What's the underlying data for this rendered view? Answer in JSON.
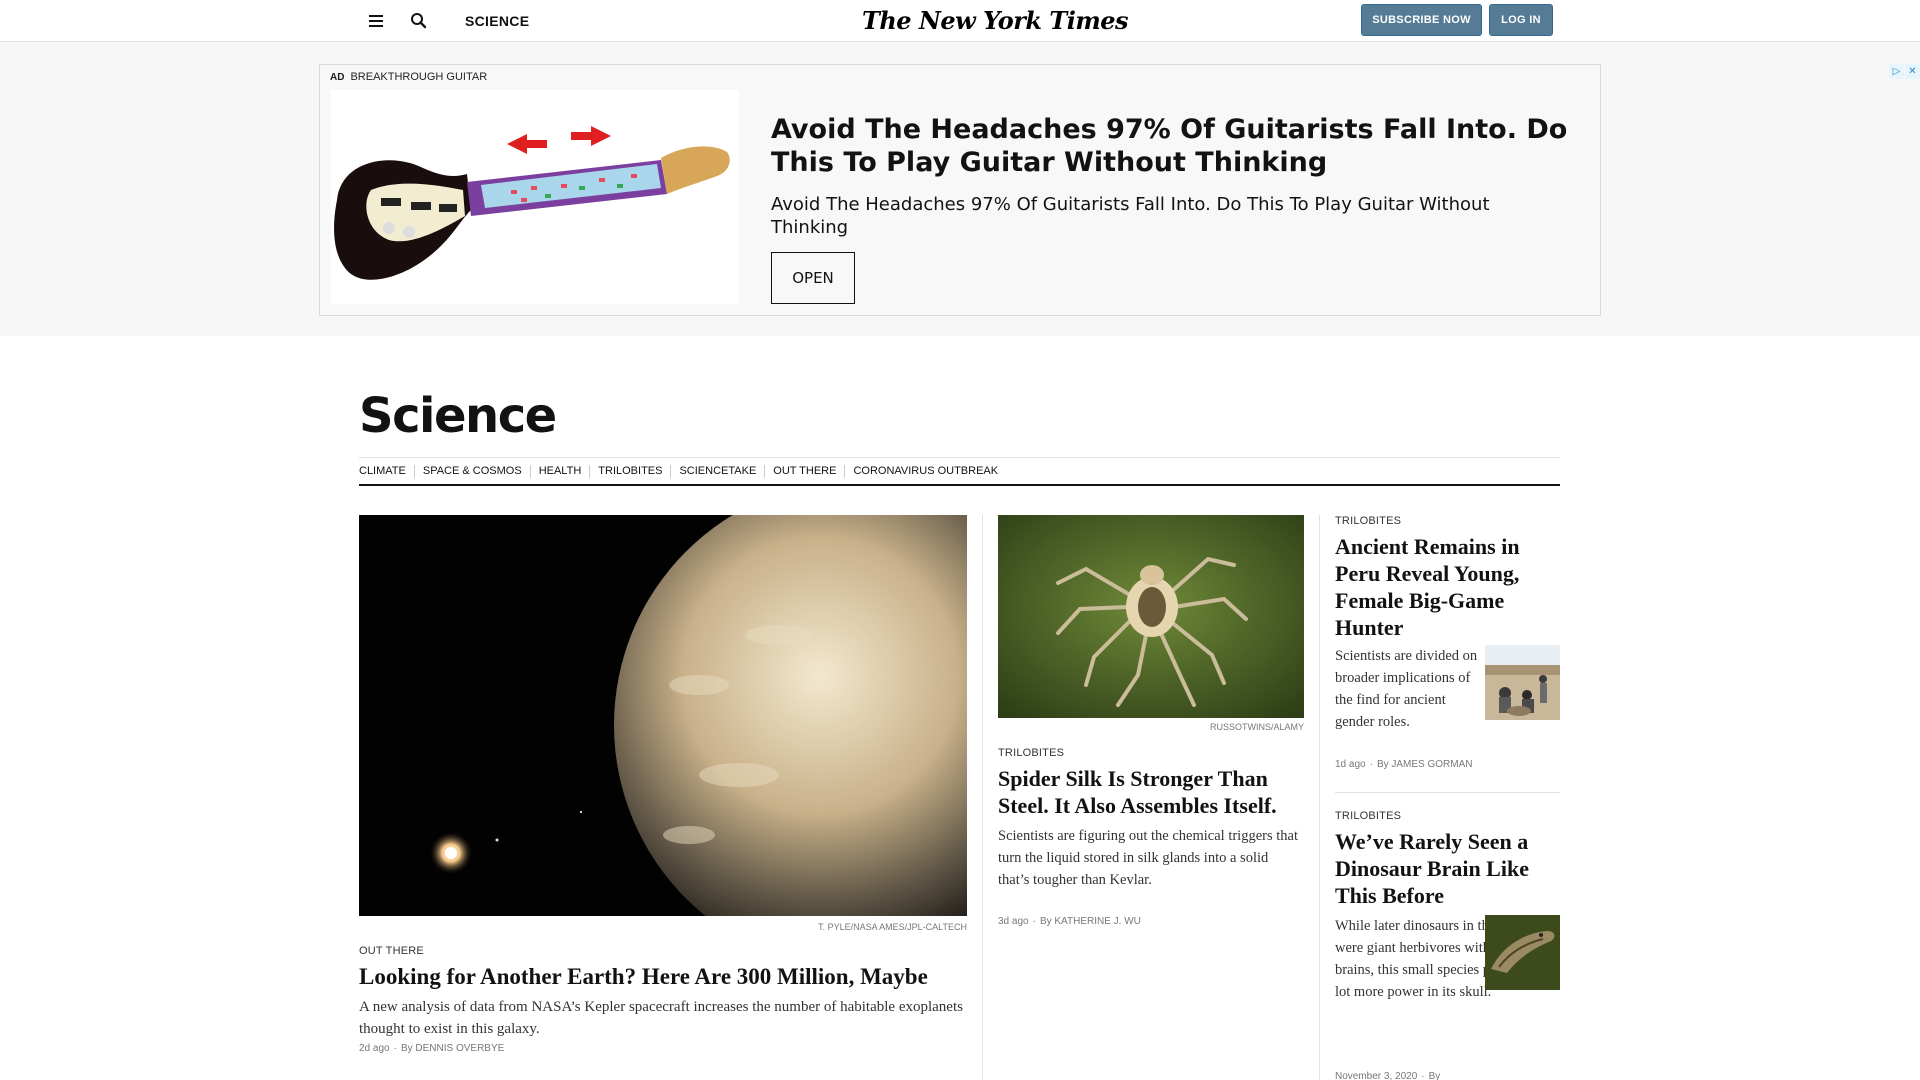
{
  "header": {
    "section": "SCIENCE",
    "masthead": "The New York Times",
    "subscribe_label": "SUBSCRIBE NOW",
    "login_label": "LOG IN"
  },
  "ad": {
    "tag": "AD",
    "advertiser": "BREAKTHROUGH GUITAR",
    "title": "Avoid The Headaches 97% Of Guitarists Fall Into. Do This To Play Guitar Without Thinking",
    "description": "Avoid The Headaches 97% Of Guitarists Fall Into. Do This To Play Guitar Without Thinking",
    "cta": "OPEN",
    "choices_icons": [
      "adchoices-icon",
      "close-icon"
    ],
    "choices_glyphs": [
      "▷",
      "✕"
    ]
  },
  "page": {
    "title": "Science",
    "subnav": [
      "CLIMATE",
      "SPACE & COSMOS",
      "HEALTH",
      "TRILOBITES",
      "SCIENCETAKE",
      "OUT THERE",
      "CORONAVIRUS OUTBREAK"
    ]
  },
  "stories": {
    "lead": {
      "credit": "T. PYLE/NASA AMES/JPL-CALTECH",
      "kicker": "OUT THERE",
      "headline": "Looking for Another Earth? Here Are 300 Million, Maybe",
      "summary": "A new analysis of data from NASA’s Kepler spacecraft increases the number of habitable exoplanets thought to exist in this galaxy.",
      "time": "2d ago",
      "byline": "By DENNIS OVERBYE"
    },
    "middle": {
      "credit": "RUSSOTWINS/ALAMY",
      "kicker": "TRILOBITES",
      "headline": "Spider Silk Is Stronger Than Steel. It Also Assembles Itself.",
      "summary": "Scientists are figuring out the chemical triggers that turn the liquid stored in silk glands into a solid that’s tougher than Kevlar.",
      "time": "3d ago",
      "byline": "By KATHERINE J. WU"
    },
    "right": [
      {
        "kicker": "TRILOBITES",
        "headline": "Ancient Remains in Peru Reveal Young, Female Big-Game Hunter",
        "summary": "Scientists are divided on broader implications of the find for ancient gender roles.",
        "time": "1d ago",
        "byline": "By JAMES GORMAN"
      },
      {
        "kicker": "TRILOBITES",
        "headline": "We’ve Rarely Seen a Dinosaur Brain Like This Before",
        "summary": "While later dinosaurs in this lineage were giant herbivores with tiny brains, this small species packed a lot more power in its skull.",
        "time": "November 3, 2020",
        "byline": "By"
      }
    ]
  }
}
